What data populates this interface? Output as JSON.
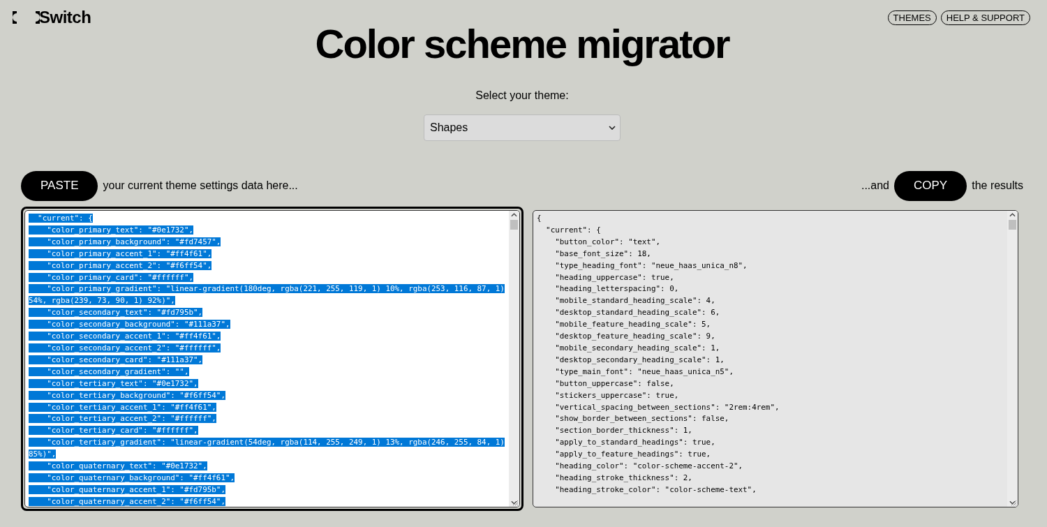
{
  "brand": {
    "name": "Switch"
  },
  "nav": [
    {
      "label": "THEMES"
    },
    {
      "label": "HELP & SUPPORT"
    }
  ],
  "title": "Color scheme migrator",
  "theme_select": {
    "label": "Select your theme:",
    "value": "Shapes"
  },
  "paste": {
    "button": "PASTE",
    "text": "your current theme settings data here..."
  },
  "copy": {
    "before": "...and",
    "button": "COPY",
    "after": "the results"
  },
  "input_panel": {
    "focused": true,
    "selected": true,
    "lines": [
      "  \"current\": {",
      "    \"color_primary_text\": \"#0e1732\",",
      "    \"color_primary_background\": \"#fd7457\",",
      "    \"color_primary_accent_1\": \"#ff4f61\",",
      "    \"color_primary_accent_2\": \"#f6ff54\",",
      "    \"color_primary_card\": \"#ffffff\",",
      "    \"color_primary_gradient\": \"linear-gradient(180deg, rgba(221, 255, 119, 1) 10%, rgba(253, 116, 87, 1)",
      "54%, rgba(239, 73, 90, 1) 92%)\",",
      "    \"color_secondary_text\": \"#fd795b\",",
      "    \"color_secondary_background\": \"#111a37\",",
      "    \"color_secondary_accent_1\": \"#ff4f61\",",
      "    \"color_secondary_accent_2\": \"#ffffff\",",
      "    \"color_secondary_card\": \"#111a37\",",
      "    \"color_secondary_gradient\": \"\",",
      "    \"color_tertiary_text\": \"#0e1732\",",
      "    \"color_tertiary_background\": \"#f6ff54\",",
      "    \"color_tertiary_accent_1\": \"#ff4f61\",",
      "    \"color_tertiary_accent_2\": \"#ffffff\",",
      "    \"color_tertiary_card\": \"#ffffff\",",
      "    \"color_tertiary_gradient\": \"linear-gradient(54deg, rgba(114, 255, 249, 1) 13%, rgba(246, 255, 84, 1)",
      "85%)\",",
      "    \"color_quaternary_text\": \"#0e1732\",",
      "    \"color_quaternary_background\": \"#ff4f61\",",
      "    \"color_quaternary_accent_1\": \"#fd795b\",",
      "    \"color_quaternary_accent_2\": \"#f6ff54\","
    ]
  },
  "output_panel": {
    "focused": false,
    "selected": false,
    "lines": [
      "{",
      "  \"current\": {",
      "    \"button_color\": \"text\",",
      "    \"base_font_size\": 18,",
      "    \"type_heading_font\": \"neue_haas_unica_n8\",",
      "    \"heading_uppercase\": true,",
      "    \"heading_letterspacing\": 0,",
      "    \"mobile_standard_heading_scale\": 4,",
      "    \"desktop_standard_heading_scale\": 6,",
      "    \"mobile_feature_heading_scale\": 5,",
      "    \"desktop_feature_heading_scale\": 9,",
      "    \"mobile_secondary_heading_scale\": 1,",
      "    \"desktop_secondary_heading_scale\": 1,",
      "    \"type_main_font\": \"neue_haas_unica_n5\",",
      "    \"button_uppercase\": false,",
      "    \"stickers_uppercase\": true,",
      "    \"vertical_spacing_between_sections\": \"2rem:4rem\",",
      "    \"show_border_between_sections\": false,",
      "    \"section_border_thickness\": 1,",
      "    \"apply_to_standard_headings\": true,",
      "    \"apply_to_feature_headings\": true,",
      "    \"heading_color\": \"color-scheme-accent-2\",",
      "    \"heading_stroke_thickness\": 2,",
      "    \"heading_stroke_color\": \"color-scheme-text\","
    ]
  }
}
